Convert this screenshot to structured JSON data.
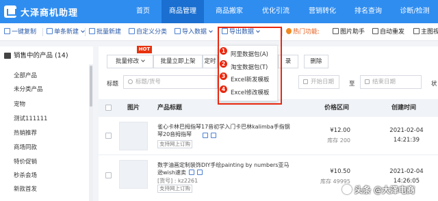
{
  "app": {
    "name": "大泽商机助理"
  },
  "nav": {
    "items": [
      {
        "label": "首页"
      },
      {
        "label": "商品管理"
      },
      {
        "label": "商品搬家"
      },
      {
        "label": "优化引流"
      },
      {
        "label": "营销转化"
      },
      {
        "label": "排名查询"
      },
      {
        "label": "诊断/检测"
      }
    ],
    "active": "商品管理"
  },
  "toolbar": {
    "copy": "一键复制",
    "single_new": "单条新建",
    "batch_new": "批量新建",
    "custom_category": "自定义分类",
    "import": "导入数据",
    "export": "导出数据",
    "hot": "热门功能:",
    "image_helper": "图片助手",
    "auto_publish": "自动重发",
    "main_image": "主图视"
  },
  "sidebar": {
    "header": "销售中的产品 (14)",
    "items": [
      "全部产品",
      "未分类产品",
      "宠物",
      "测试111111",
      "热销推荐",
      "商场同款",
      "特价促销",
      "秒杀会场",
      "新款首发"
    ]
  },
  "actions": {
    "hot_badge": "HOT",
    "batch_edit": "批量修改",
    "batch_list": "批量立即上架",
    "scheduled_partial": "定时",
    "record_partial": "录",
    "delete": "删除"
  },
  "filters": {
    "title_label": "标题",
    "title_placeholder": "标题/货号",
    "start_date": "开始日期",
    "to": "至",
    "end_date": "结束日期",
    "status_partial": "状"
  },
  "table": {
    "headers": {
      "image": "图片",
      "title": "产品标题",
      "price": "价格区间",
      "created": "创建时间"
    },
    "rows": [
      {
        "title": "雀心卡林巴拇指琴17音初学入门卡巴林kalimba手指钢琴20音拇指琴",
        "sku": "",
        "tag": "支持网上订购",
        "price": "¥12.00",
        "stock": "库存 200",
        "date": "2021-02-04",
        "time": "14:21:39"
      },
      {
        "title": "数字油画定制装饰DIY手绘painting by numbers亚马逊wish速卖",
        "sku": "[货号] : kz2261",
        "tag": "支持网上订购",
        "price": "¥10.50",
        "stock": "库存 49995",
        "date": "2021-02-04",
        "time": "14:26:05"
      }
    ]
  },
  "dropdown": {
    "items": [
      {
        "num": "1",
        "label": "阿里数据包(A)"
      },
      {
        "num": "2",
        "label": "淘宝数据包(T)"
      },
      {
        "num": "3",
        "label": "Excel新发模板"
      },
      {
        "num": "4",
        "label": "Excel修改模板"
      }
    ]
  },
  "watermark": {
    "text": "头条 @大泽电商"
  },
  "colors": {
    "primary": "#2f8df0",
    "highlight": "#e8280f",
    "hot": "#e55a17"
  }
}
